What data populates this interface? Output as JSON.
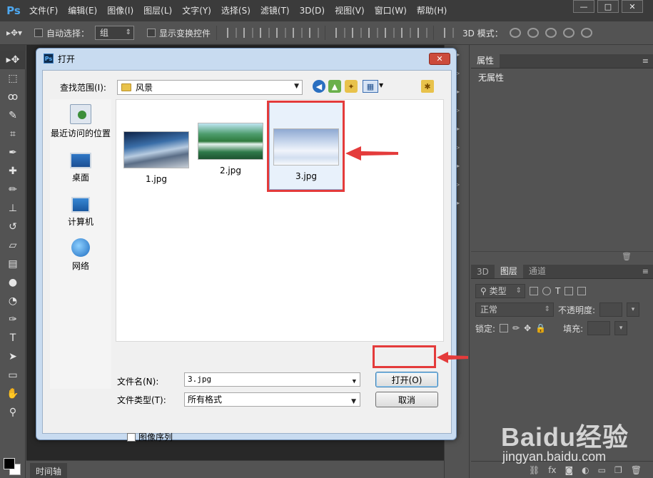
{
  "app": {
    "logo": "Ps",
    "menu": [
      "文件(F)",
      "编辑(E)",
      "图像(I)",
      "图层(L)",
      "文字(Y)",
      "选择(S)",
      "滤镜(T)",
      "3D(D)",
      "视图(V)",
      "窗口(W)",
      "帮助(H)"
    ],
    "window_buttons": [
      "—",
      "□",
      "✕"
    ]
  },
  "options_bar": {
    "tool_icon": "move-tool-icon",
    "auto_select_label": "自动选择：",
    "auto_select_value": "组",
    "show_transform_label": "显示变换控件",
    "mode_3d_label": "3D 模式："
  },
  "panels": {
    "properties_tab": "属性",
    "properties_body": "无属性",
    "layers_tabs": [
      "3D",
      "图层",
      "通道"
    ],
    "filter_kind": "类型",
    "blend_mode": "正常",
    "opacity_label": "不透明度:",
    "lock_label": "锁定:",
    "fill_label": "填充:",
    "timeline_tab": "时间轴"
  },
  "dialog": {
    "title": "打开",
    "close_label": "✕",
    "look_in_label": "查找范围(I):",
    "look_in_value": "风景",
    "places": [
      {
        "label": "最近访问的位置",
        "icon": "recent-places-icon"
      },
      {
        "label": "桌面",
        "icon": "desktop-icon"
      },
      {
        "label": "计算机",
        "icon": "computer-icon"
      },
      {
        "label": "网络",
        "icon": "network-icon"
      }
    ],
    "files": [
      {
        "name": "1.jpg",
        "selected": false
      },
      {
        "name": "2.jpg",
        "selected": false
      },
      {
        "name": "3.jpg",
        "selected": true
      }
    ],
    "file_name_label": "文件名(N):",
    "file_name_value": "3.jpg",
    "file_type_label": "文件类型(T):",
    "file_type_value": "所有格式",
    "open_button": "打开(O)",
    "cancel_button": "取消",
    "image_sequence_label": "图像序列"
  },
  "annotations": {
    "highlight_color": "#e43b3b"
  },
  "watermark": {
    "logo": "Baidu经验",
    "url": "jingyan.baidu.com"
  }
}
